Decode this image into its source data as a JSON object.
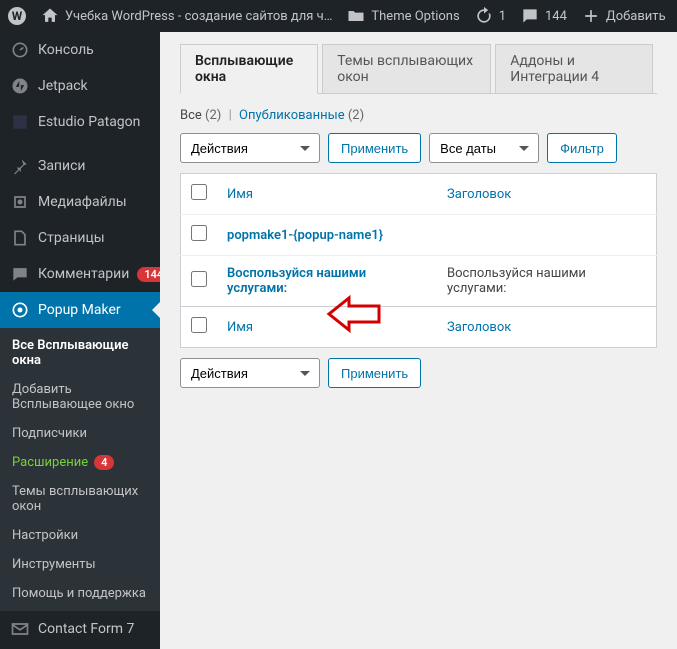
{
  "toolbar": {
    "site_title": "Учебка WordPress - создание сайтов для ч…",
    "theme_options": "Theme Options",
    "updates": "1",
    "comments": "144",
    "add_new": "Добавить"
  },
  "sidebar": {
    "console": "Консоль",
    "jetpack": "Jetpack",
    "estudio": "Estudio Patagon",
    "posts": "Записи",
    "media": "Медиафайлы",
    "pages": "Страницы",
    "comments": "Комментарии",
    "comments_badge": "144",
    "popup_maker": "Popup Maker",
    "submenu": {
      "all_popups": "Все Всплывающие окна",
      "add_popup": "Добавить Всплывающее окно",
      "subscribers": "Подписчики",
      "extend": "Расширение",
      "extend_badge": "4",
      "themes": "Темы всплывающих окон",
      "settings": "Настройки",
      "tools": "Инструменты",
      "help": "Помощь и поддержка"
    },
    "contact_form": "Contact Form 7"
  },
  "content": {
    "tabs": {
      "popups": "Всплывающие окна",
      "themes": "Темы всплывающих окон",
      "addons": "Аддоны и Интеграции 4"
    },
    "subsub": {
      "all": "Все",
      "all_count": "(2)",
      "published": "Опубликованные",
      "published_count": "(2)"
    },
    "bulk": {
      "actions": "Действия",
      "apply": "Применить"
    },
    "filter": {
      "all_dates": "Все даты",
      "filter_btn": "Фильтр"
    },
    "columns": {
      "name": "Имя",
      "title": "Заголовок"
    },
    "rows": [
      {
        "name": "popmake1-{popup-name1}",
        "title_text": ""
      },
      {
        "name": "Воспользуйся нашими услугами:",
        "title_text": "Воспользуйся нашими услугами:"
      }
    ],
    "bulk2": {
      "actions": "Действия",
      "apply": "Применить"
    }
  }
}
